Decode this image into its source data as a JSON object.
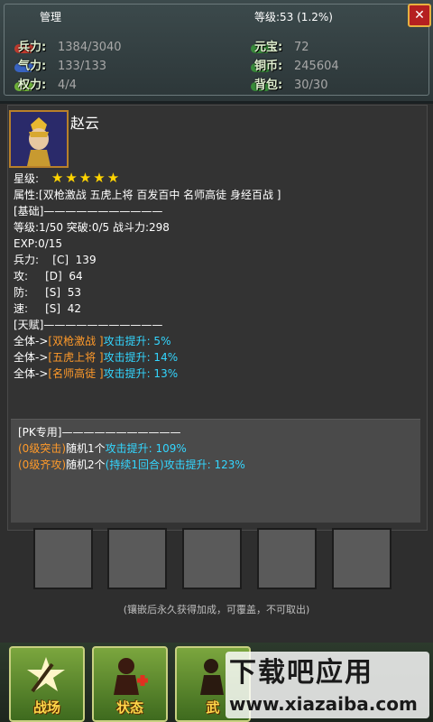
{
  "header": {
    "title": "管理",
    "level": "等级:53 (1.2%)",
    "close_label": "✕",
    "stats_left": [
      {
        "label": "兵力:",
        "value": "1384/3040",
        "color": "#d83a2a"
      },
      {
        "label": "气力:",
        "value": "133/133",
        "color": "#3a6ad8"
      },
      {
        "label": "权力:",
        "value": "4/4",
        "color": "#7ac83a"
      }
    ],
    "stats_right": [
      {
        "label": "元宝:",
        "value": "72",
        "color": "#3a9a3a"
      },
      {
        "label": "铜币:",
        "value": "245604",
        "color": "#3a9a3a"
      },
      {
        "label": "背包:",
        "value": "30/30",
        "color": "#3a9a3a"
      }
    ]
  },
  "hero": {
    "name": "赵云",
    "star_label": "星级:",
    "stars": 5,
    "attributes": "属性:[双枪激战 五虎上将 百发百中 名师高徒 身经百战 ]",
    "basic_header": "[基础]———————————",
    "level_line": "等级:1/50  突破:0/5  战斗力:298",
    "exp_line": "EXP:0/15",
    "troops": "兵力:    [C]  139",
    "attack": "攻:     [D]  64",
    "defense": "防:     [S]  53",
    "speed": "速:     [S]  42",
    "talent_header": "[天赋]———————————",
    "talents": [
      {
        "prefix": "全体->",
        "name": "[双枪激战 ]",
        "effect": "攻击提升: 5%"
      },
      {
        "prefix": "全体->",
        "name": "[五虎上将 ]",
        "effect": "攻击提升: 14%"
      },
      {
        "prefix": "全体->",
        "name": "[名师高徒 ]",
        "effect": "攻击提升: 13%"
      }
    ]
  },
  "pk": {
    "header": "[PK专用]———————————",
    "skills": [
      {
        "name": "(0级突击)",
        "mid": "随机1个",
        "effect": "攻击提升: 109%"
      },
      {
        "name": "(0级齐攻)",
        "mid": "随机2个",
        "extra": "(持续1回合)",
        "effect": "攻击提升: 123%"
      }
    ]
  },
  "slots_hint": "(镶嵌后永久获得加成，可覆盖，不可取出)",
  "tabs": [
    {
      "label": "战场",
      "icon": "battle-icon"
    },
    {
      "label": "状态",
      "icon": "status-icon"
    },
    {
      "label": "武",
      "icon": "martial-icon"
    }
  ],
  "watermark": {
    "main": "下载吧应用",
    "url": "www.xiazaiba.com"
  }
}
